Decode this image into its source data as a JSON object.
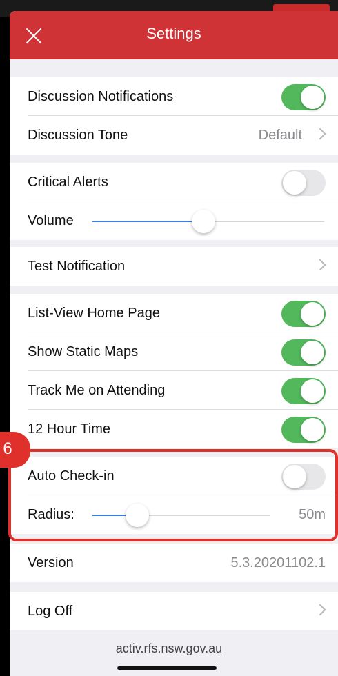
{
  "header": {
    "title": "Settings"
  },
  "rows": {
    "discussion_notifications": {
      "label": "Discussion Notifications",
      "on": true
    },
    "discussion_tone": {
      "label": "Discussion Tone",
      "value": "Default"
    },
    "critical_alerts": {
      "label": "Critical Alerts",
      "on": false
    },
    "volume": {
      "label": "Volume",
      "level_percent": 48
    },
    "test_notification": {
      "label": "Test Notification"
    },
    "list_view_home": {
      "label": "List-View Home Page",
      "on": true
    },
    "show_static_maps": {
      "label": "Show Static Maps",
      "on": true
    },
    "track_me": {
      "label": "Track Me on Attending",
      "on": true
    },
    "hour12": {
      "label": "12 Hour Time",
      "on": true
    },
    "auto_checkin": {
      "label": "Auto Check-in",
      "on": false
    },
    "radius": {
      "label": "Radius:",
      "value": "50m",
      "level_percent": 25
    },
    "version": {
      "label": "Version",
      "value": "5.3.20201102.1"
    },
    "log_off": {
      "label": "Log Off"
    }
  },
  "annotation": {
    "step": "6"
  },
  "footer": {
    "url": "activ.rfs.nsw.gov.au"
  },
  "colors": {
    "nav": "#d03336",
    "toggle_on": "#53b85c",
    "slider": "#3b7ee0",
    "highlight": "#e0302b"
  }
}
